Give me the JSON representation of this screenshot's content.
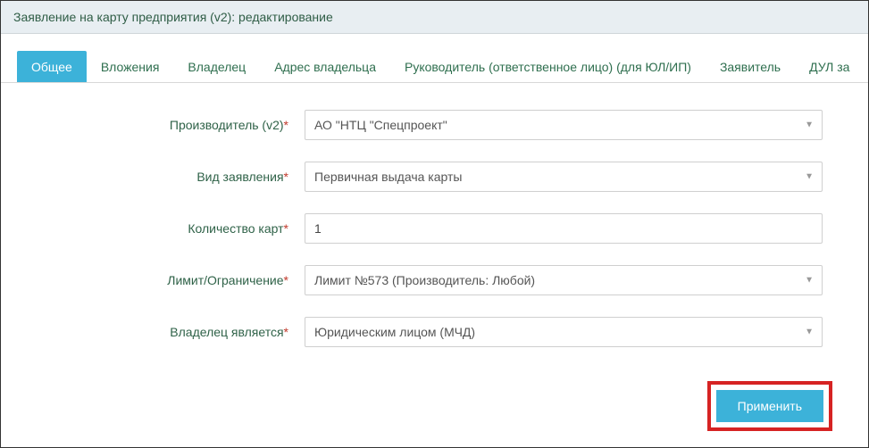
{
  "header": {
    "title": "Заявление на карту предприятия (v2): редактирование"
  },
  "tabs": [
    {
      "label": "Общее",
      "active": true
    },
    {
      "label": "Вложения"
    },
    {
      "label": "Владелец"
    },
    {
      "label": "Адрес владельца"
    },
    {
      "label": "Руководитель (ответственное лицо) (для ЮЛ/ИП)"
    },
    {
      "label": "Заявитель"
    },
    {
      "label": "ДУЛ за"
    }
  ],
  "fields": {
    "manufacturer": {
      "label": "Производитель (v2)",
      "required": true,
      "value": "АО \"НТЦ \"Спецпроект\""
    },
    "applicationType": {
      "label": "Вид заявления",
      "required": true,
      "value": "Первичная выдача карты"
    },
    "cardCount": {
      "label": "Количество карт",
      "required": true,
      "value": "1"
    },
    "limit": {
      "label": "Лимит/Ограничение",
      "required": true,
      "value": "Лимит №573 (Производитель: Любой)"
    },
    "ownerIs": {
      "label": "Владелец является",
      "required": true,
      "value": "Юридическим лицом (МЧД)"
    }
  },
  "actions": {
    "apply": "Применить"
  },
  "marks": {
    "required": "*"
  }
}
